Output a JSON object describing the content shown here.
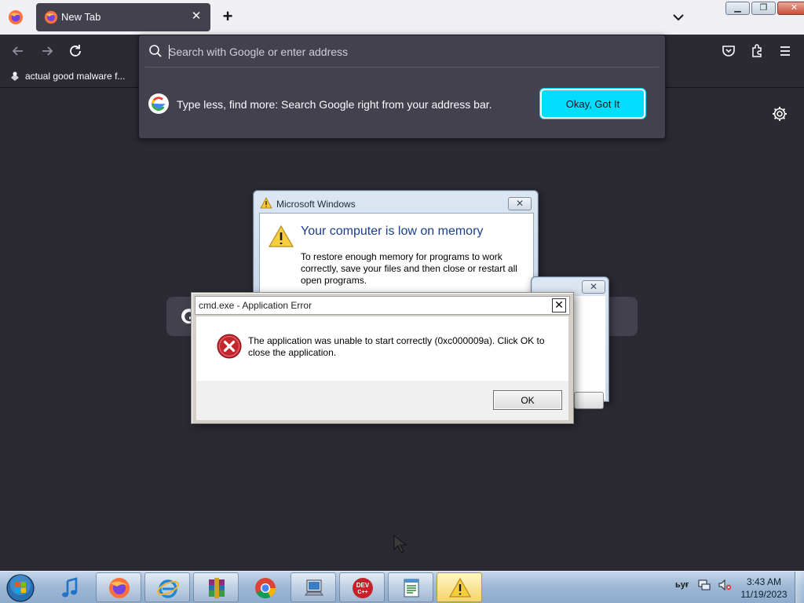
{
  "browser": {
    "tab": {
      "title": "New Tab",
      "close_glyph": "✕"
    },
    "new_tab_glyph": "+",
    "bookmarks": [
      {
        "label": "actual good malware f..."
      }
    ],
    "urlbar": {
      "placeholder": "Search with Google or enter address",
      "promo_text": "Type less, find more: Search Google right from your address bar.",
      "promo_button": "Okay, Got It"
    },
    "icons": [
      "firefox-icon",
      "back-icon",
      "forward-icon",
      "reload-icon",
      "pocket-icon",
      "extensions-icon",
      "hamburger-menu-icon",
      "settings-gear-icon",
      "google-icon"
    ]
  },
  "windows": {
    "memory_dialog": {
      "title": "Microsoft Windows",
      "heading": "Your computer is low on memory",
      "text": "To restore enough memory for programs to work correctly, save your files and then close or restart all open programs.",
      "close_glyph": "✕"
    },
    "background_dialog": {
      "close_glyph": "✕"
    },
    "error_dialog": {
      "title": "cmd.exe - Application Error",
      "message": "The application was unable to start correctly (0xc000009a). Click OK to close the application.",
      "ok_label": "OK",
      "close_glyph": "✕"
    }
  },
  "taskbar": {
    "pinned": [
      "itunes-icon",
      "firefox-icon",
      "internet-explorer-icon",
      "winrar-icon",
      "chrome-icon",
      "computer-icon",
      "devcpp-icon",
      "notepad-icon",
      "warning-icon"
    ],
    "tray_lang": "ьуғ",
    "clock": {
      "time": "3:43 AM",
      "date": "11/19/2023"
    },
    "colors": {
      "accent": "#00ddff",
      "error_red": "#c4262e"
    }
  }
}
